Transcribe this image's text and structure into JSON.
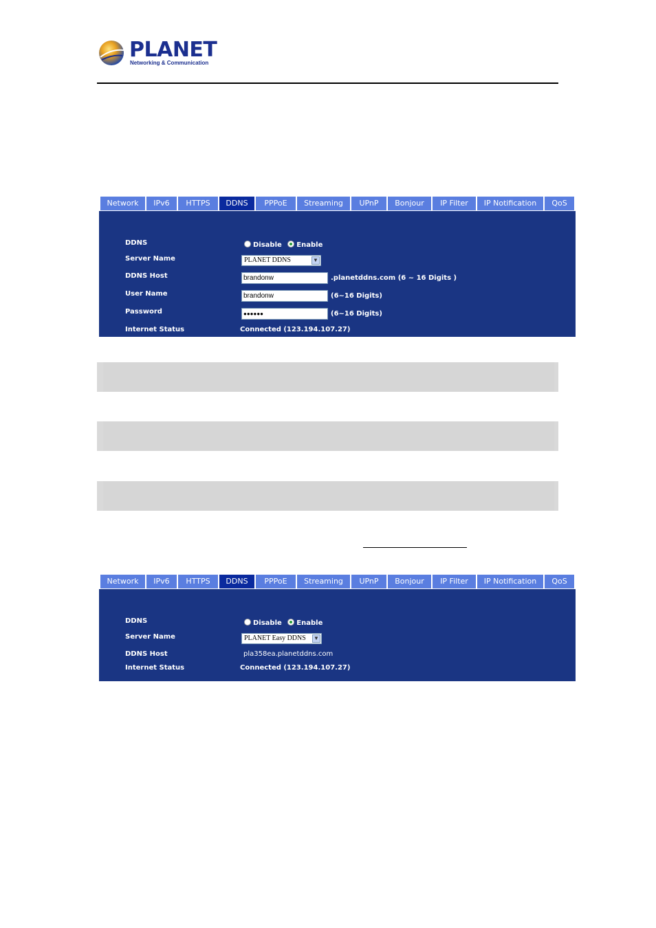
{
  "logo": {
    "brand": "PLANET",
    "tagline": "Networking & Communication"
  },
  "tabs": [
    "Network",
    "IPv6",
    "HTTPS",
    "DDNS",
    "PPPoE",
    "Streaming",
    "UPnP",
    "Bonjour",
    "IP Filter",
    "IP Notification",
    "QoS"
  ],
  "active_tab": "DDNS",
  "panel1": {
    "ddns_label": "DDNS",
    "disable_label": "Disable",
    "enable_label": "Enable",
    "selected": "Enable",
    "server_name_label": "Server Name",
    "server_name_value": "PLANET DDNS",
    "ddns_host_label": "DDNS Host",
    "ddns_host_value": "brandonw",
    "ddns_host_hint": ".planetddns.com (6 ~ 16 Digits )",
    "user_name_label": "User Name",
    "user_name_value": "brandonw",
    "user_name_hint": "(6~16 Digits)",
    "password_label": "Password",
    "password_value": "●●●●●●",
    "password_hint": "(6~16 Digits)",
    "internet_status_label": "Internet Status",
    "internet_status_value": "Connected (123.194.107.27)"
  },
  "panel2": {
    "ddns_label": "DDNS",
    "disable_label": "Disable",
    "enable_label": "Enable",
    "selected": "Enable",
    "server_name_label": "Server Name",
    "server_name_value": "PLANET Easy DDNS",
    "ddns_host_label": "DDNS Host",
    "ddns_host_value": "pla358ea.planetddns.com",
    "internet_status_label": "Internet Status",
    "internet_status_value": "Connected (123.194.107.27)"
  },
  "colors": {
    "panel_bg": "#1a3583",
    "tab_bg": "#5a7ee0",
    "tab_active": "#0a2a9e",
    "brand": "#1b2f8f"
  }
}
